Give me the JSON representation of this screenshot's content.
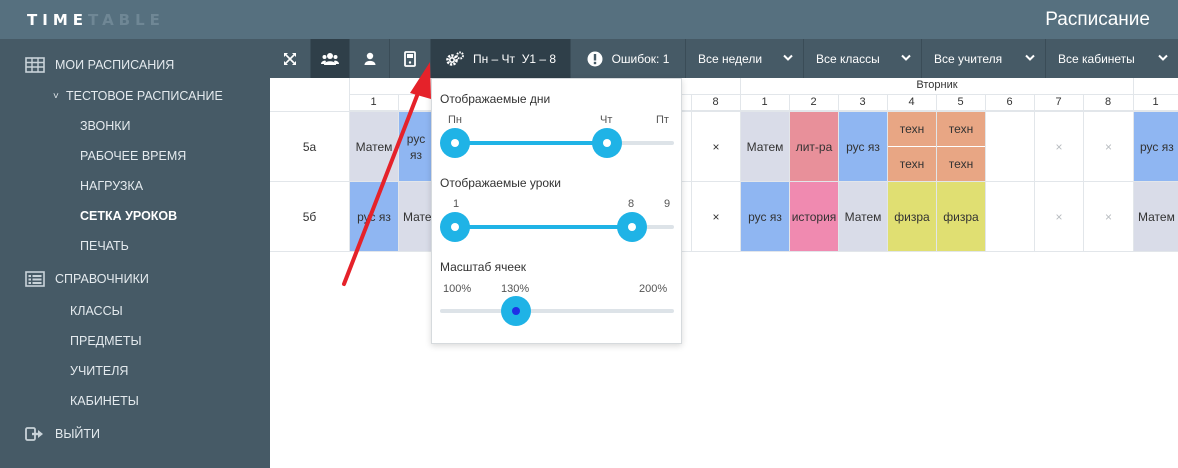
{
  "header": {
    "logo_bright": "TIME",
    "logo_dim": "TABLE",
    "title": "Расписание"
  },
  "sidebar": {
    "my_schedules": "МОИ РАСПИСАНИЯ",
    "test_schedule": "ТЕСТОВОЕ РАСПИСАНИЕ",
    "bells": "ЗВОНКИ",
    "work_time": "РАБОЧЕЕ ВРЕМЯ",
    "load": "НАГРУЗКА",
    "lesson_grid": "СЕТКА УРОКОВ",
    "print": "ПЕЧАТЬ",
    "references": "СПРАВОЧНИКИ",
    "classes": "КЛАССЫ",
    "subjects": "ПРЕДМЕТЫ",
    "teachers": "УЧИТЕЛЯ",
    "rooms": "КАБИНЕТЫ",
    "logout": "ВЫЙТИ"
  },
  "toolbar": {
    "settings_label": "Пн – Чт  У1 – 8",
    "errors_label": "Ошибок: 1",
    "weeks": "Все недели",
    "classes": "Все классы",
    "teachers": "Все учителя",
    "rooms": "Все кабинеты"
  },
  "grid": {
    "day_tuesday": "Вторник",
    "mon_visible_lessons": [
      "1",
      "8"
    ],
    "tue_lessons": [
      "1",
      "2",
      "3",
      "4",
      "5",
      "6",
      "7",
      "8"
    ],
    "wed_first_lesson": "1",
    "classes": [
      "5а",
      "5б"
    ],
    "row_5a": {
      "mon_1": "Матем",
      "mon_2": "рус яз",
      "tue_1": "Матем",
      "tue_2": "лит-ра",
      "tue_3": "рус яз",
      "tue_4a": "техн",
      "tue_4b": "техн",
      "tue_5a": "техн",
      "tue_5b": "техн",
      "wed_1": "рус яз"
    },
    "row_5b": {
      "mon_1": "рус яз",
      "mon_2": "Матем",
      "tue_1": "рус яз",
      "tue_2": "история",
      "tue_3": "Матем",
      "tue_4": "физра",
      "tue_5": "физра",
      "wed_1": "Матем"
    },
    "empty_mark": "×"
  },
  "popup": {
    "days_label": "Отображаемые дни",
    "days_ticks": [
      "Пн",
      "Чт",
      "Пт"
    ],
    "days_range": [
      "Пн",
      "Чт"
    ],
    "lessons_label": "Отображаемые уроки",
    "lessons_ticks": [
      "1",
      "8",
      "9"
    ],
    "lessons_range": [
      1,
      8
    ],
    "scale_label": "Масштаб ячеек",
    "scale_ticks": [
      "100%",
      "130%",
      "200%"
    ],
    "scale_value": 130
  },
  "colors": {
    "header": "#56707f",
    "sidebar": "#465a66",
    "accent": "#1fb3e6",
    "math": "#d9dce8",
    "russian": "#8fb6f2",
    "literature": "#e8909a",
    "tech": "#e8a684",
    "history": "#f08ab0",
    "pe": "#e0df72",
    "arrow": "#e5222a"
  }
}
